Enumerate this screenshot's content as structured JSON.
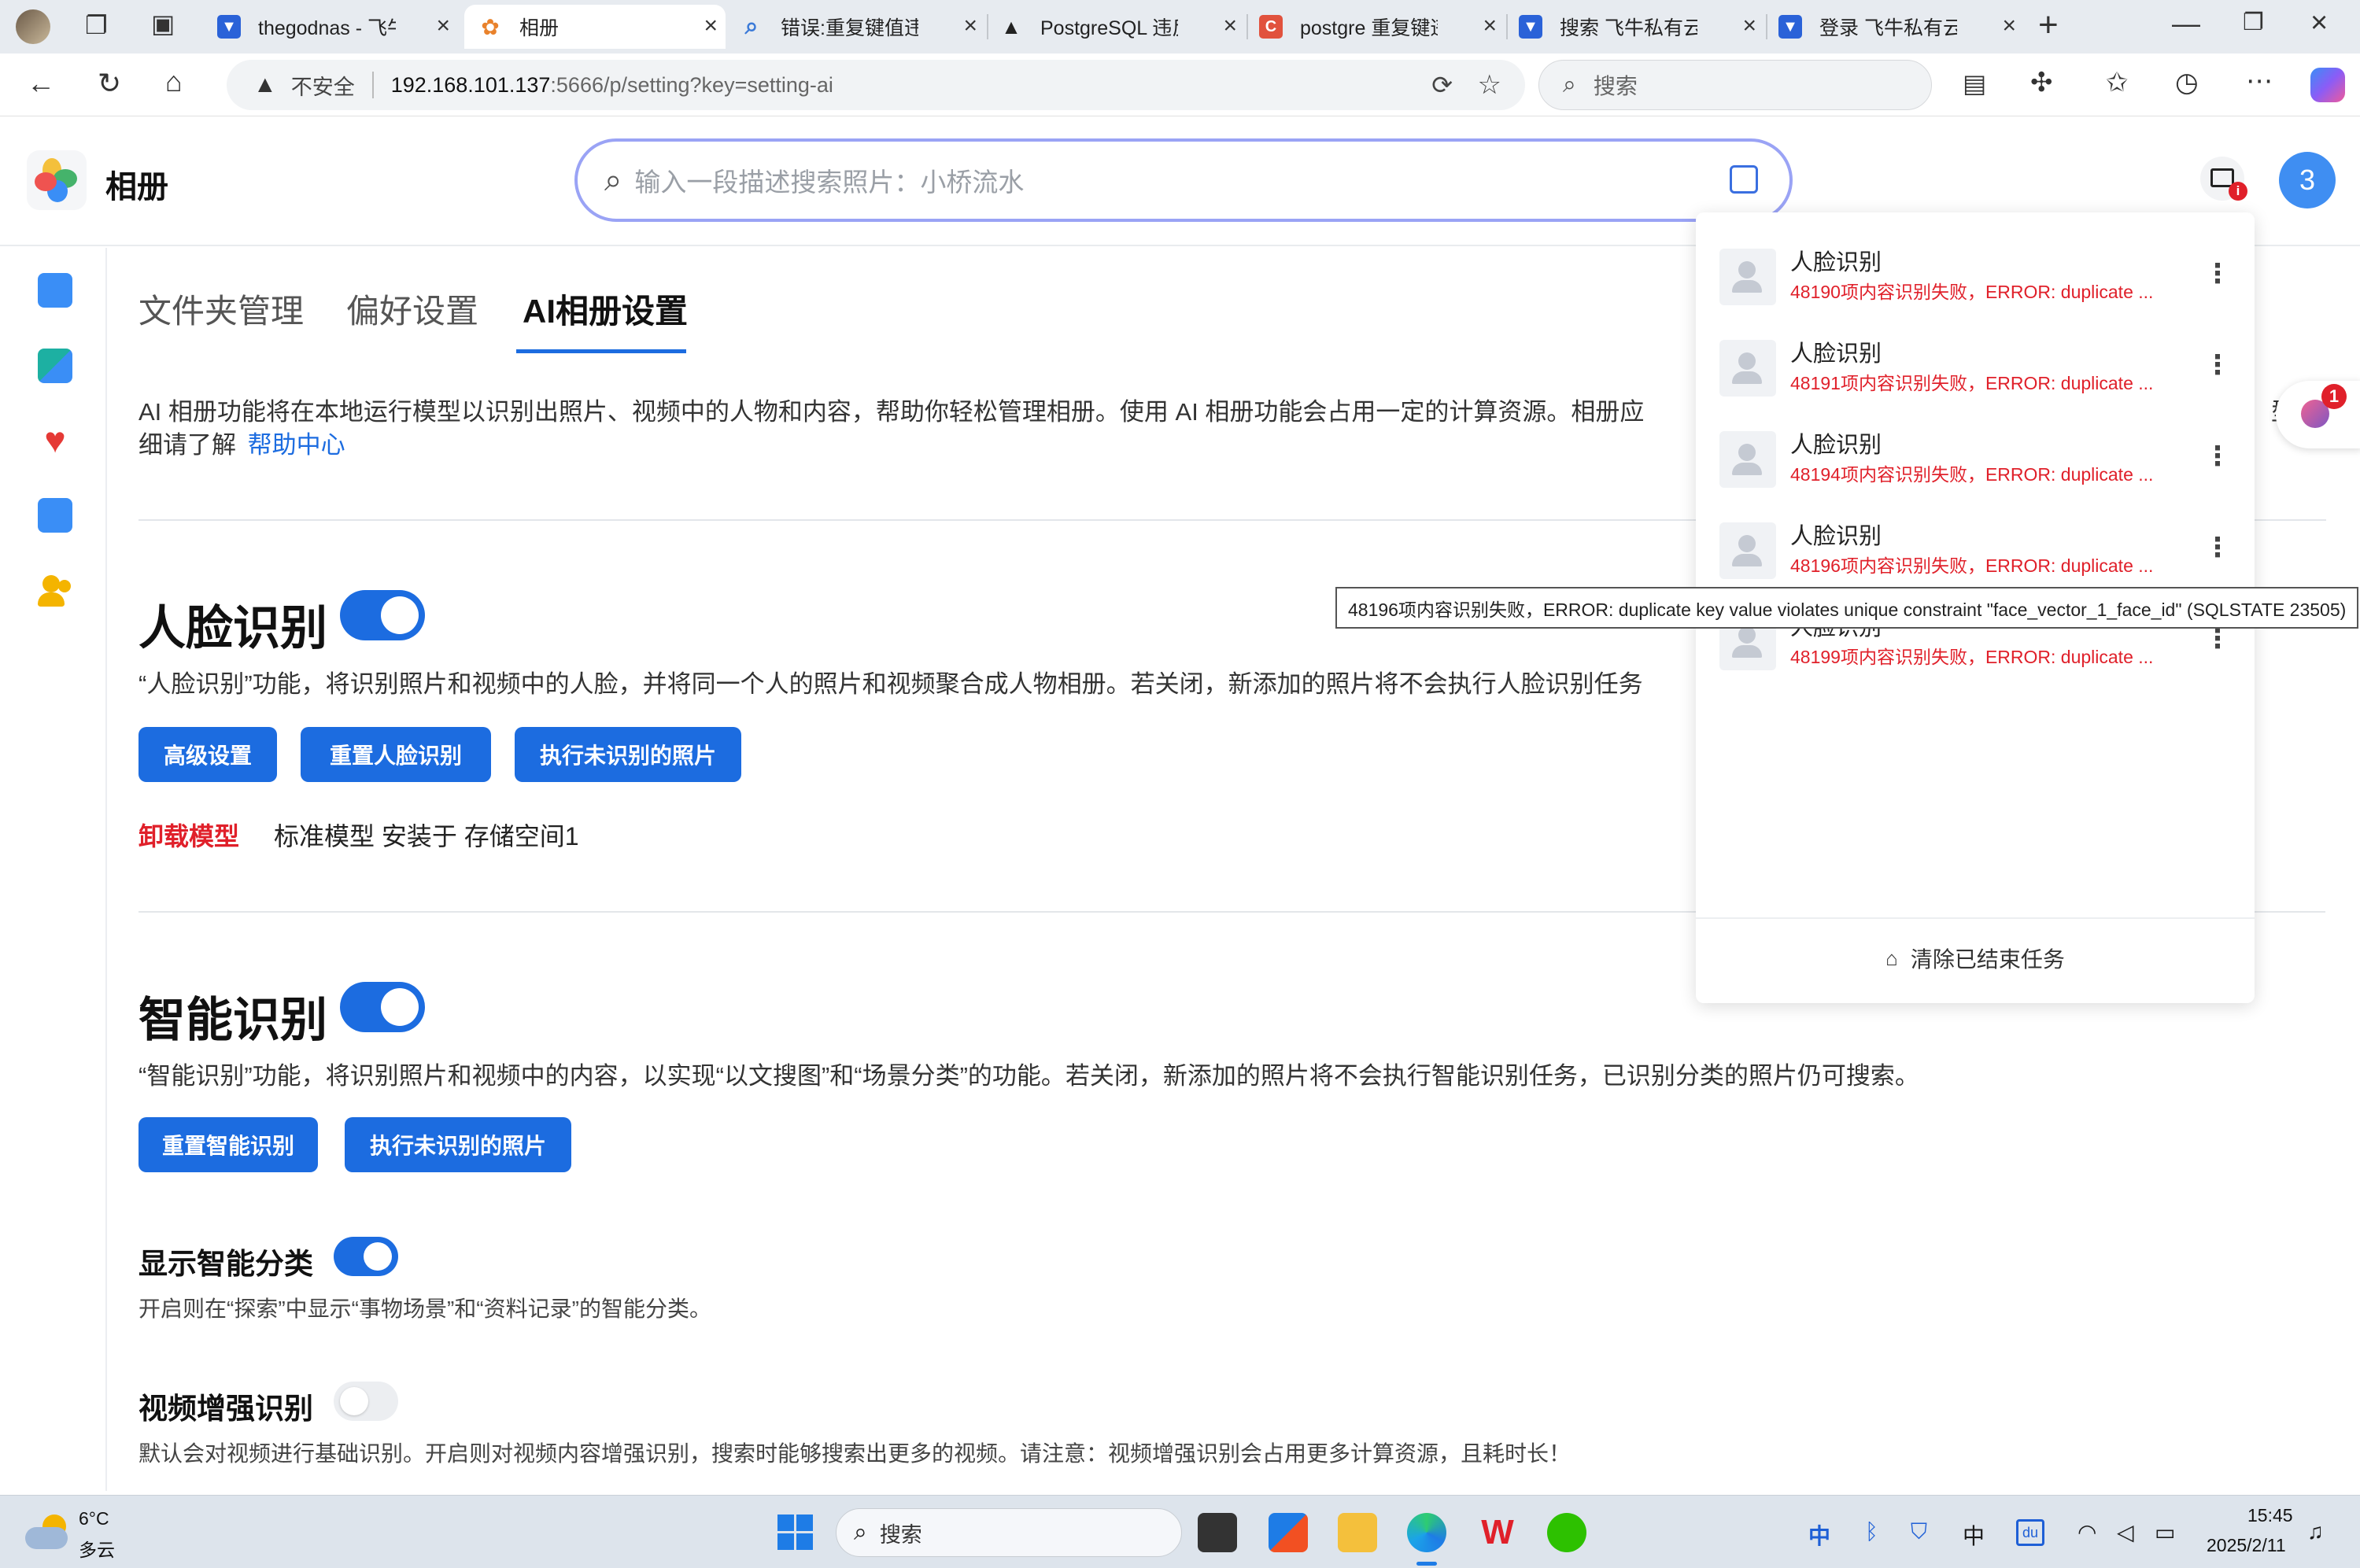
{
  "browser": {
    "tabs": [
      {
        "label": "thegodnas - 飞牛私",
        "fav_color": "#2a62d8",
        "fav_glyph": "▼"
      },
      {
        "label": "相册",
        "fav_color": "#f2a33a",
        "fav_glyph": "✿"
      },
      {
        "label": "错误:重复键值违反",
        "fav_color": "#3b7ad8",
        "fav_glyph": "⌕"
      },
      {
        "label": "PostgreSQL 违反唯",
        "fav_color": "#222222",
        "fav_glyph": "▲"
      },
      {
        "label": "postgre 重复键违反",
        "fav_color": "#e1523d",
        "fav_glyph": "C"
      },
      {
        "label": "搜索 飞牛私有云论",
        "fav_color": "#2a62d8",
        "fav_glyph": "▼"
      },
      {
        "label": "登录 飞牛私有云论",
        "fav_color": "#2a62d8",
        "fav_glyph": "▼"
      }
    ],
    "new_tab": "+",
    "insecure_label": "不安全",
    "url_host": "192.168.101.137",
    "url_rest": ":5666/p/setting?key=setting-ai",
    "search_placeholder": "搜索"
  },
  "app": {
    "title": "相册",
    "search_placeholder": "输入一段描述搜索照片：小桥流水",
    "avatar_text": "3",
    "notif_badge": "i",
    "floating_badge": "1"
  },
  "settings": {
    "tabs": [
      "文件夹管理",
      "偏好设置",
      "AI相册设置"
    ],
    "intro": "AI 相册功能将在本地运行模型以识别出照片、视频中的人物和内容，帮助你轻松管理相册。使用 AI 相册功能会占用一定的计算资源。相册应",
    "intro_tail": "型，",
    "intro_line2": "细请了解",
    "help_link": "帮助中心",
    "face": {
      "title": "人脸识别",
      "desc": "“人脸识别”功能，将识别照片和视频中的人脸，并将同一个人的照片和视频聚合成人物相册。若关闭，新添加的照片将不会执行人脸识别任务",
      "buttons": [
        "高级设置",
        "重置人脸识别",
        "执行未识别的照片"
      ],
      "uninstall": "卸载模型",
      "model_info": "标准模型 安装于 存储空间1"
    },
    "smart": {
      "title": "智能识别",
      "desc": "“智能识别”功能，将识别照片和视频中的内容，以实现“以文搜图”和“场景分类”的功能。若关闭，新添加的照片将不会执行智能识别任务，已识别分类的照片仍可搜索。",
      "buttons": [
        "重置智能识别",
        "执行未识别的照片"
      ]
    },
    "show_category": {
      "title": "显示智能分类",
      "desc": "开启则在“探索”中显示“事物场景”和“资料记录”的智能分类。"
    },
    "video": {
      "title": "视频增强识别",
      "desc": "默认会对视频进行基础识别。开启则对视频内容增强识别，搜索时能够搜索出更多的视频。请注意：视频增强识别会占用更多计算资源，且耗时长！"
    }
  },
  "tasks": {
    "items": [
      {
        "name": "人脸识别",
        "error": "48190项内容识别失败，ERROR: duplicate ..."
      },
      {
        "name": "人脸识别",
        "error": "48191项内容识别失败，ERROR: duplicate ..."
      },
      {
        "name": "人脸识别",
        "error": "48194项内容识别失败，ERROR: duplicate ..."
      },
      {
        "name": "人脸识别",
        "error": "48196项内容识别失败，ERROR: duplicate ..."
      },
      {
        "name": "人脸识别",
        "error": "48199项内容识别失败，ERROR: duplicate ..."
      }
    ],
    "more": "⋮",
    "clear_label": "清除已结束任务",
    "tooltip": "48196项内容识别失败，ERROR: duplicate key value violates unique constraint \"face_vector_1_face_id\" (SQLSTATE 23505)"
  },
  "taskbar": {
    "weather_temp": "6°C",
    "weather_desc": "多云",
    "search_label": "搜索",
    "ime": "中",
    "ime2": "中",
    "time": "15:45",
    "date": "2025/2/11"
  }
}
